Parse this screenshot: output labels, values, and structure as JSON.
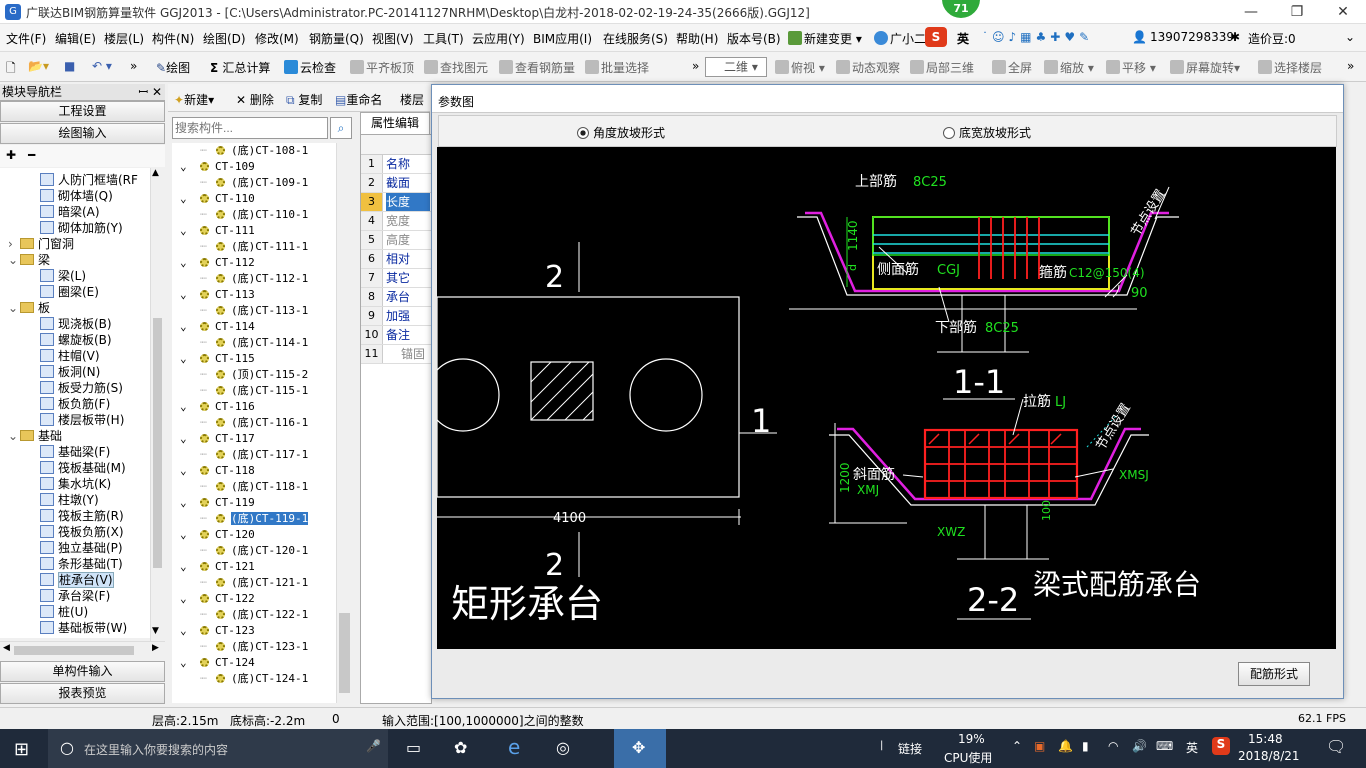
{
  "window": {
    "title": "广联达BIM钢筋算量软件 GGJ2013 - [C:\\Users\\Administrator.PC-20141127NRHM\\Desktop\\白龙村-2018-02-02-19-24-35(2666版).GGJ12]",
    "badge": "71",
    "minimize": "—",
    "restore": "❐",
    "close": "✕"
  },
  "menu": [
    "文件(F)",
    "编辑(E)",
    "楼层(L)",
    "构件(N)",
    "绘图(D)",
    "修改(M)",
    "钢筋量(Q)",
    "视图(V)",
    "工具(T)",
    "云应用(Y)",
    "BIM应用(I)",
    "在线服务(S)",
    "帮助(H)",
    "版本号(B)",
    "新建变更 ▾",
    "广小二"
  ],
  "menu_right": {
    "ime": "英",
    "phone": "13907298339",
    "price": "造价豆:0"
  },
  "toolbar": {
    "draw": "绘图",
    "sum": "汇总计算",
    "cloud_check": "云检查",
    "align_top": "平齐板顶",
    "find": "查找图元",
    "view_rebar": "查看钢筋量",
    "batch": "批量选择",
    "view_mode": "二维",
    "top_view": "俯视",
    "dynamic": "动态观察",
    "local3d": "局部三维",
    "fullscreen": "全屏",
    "zoom": "缩放",
    "pan": "平移",
    "rotate": "屏幕旋转",
    "select_floor": "选择楼层"
  },
  "nav": {
    "header": "模块导航栏",
    "pin": "ꟷ ✕",
    "project": "工程设置",
    "draw_input": "绘图输入",
    "single": "单构件输入",
    "report": "报表预览"
  },
  "tree": [
    {
      "label": "人防门框墙(RF",
      "indent": 3
    },
    {
      "label": "砌体墙(Q)",
      "indent": 3
    },
    {
      "label": "暗梁(A)",
      "indent": 3
    },
    {
      "label": "砌体加筋(Y)",
      "indent": 3
    },
    {
      "label": "门窗洞",
      "indent": 1,
      "folder": true,
      "arrow": "›"
    },
    {
      "label": "梁",
      "indent": 1,
      "folder": true,
      "arrow": "⌄"
    },
    {
      "label": "梁(L)",
      "indent": 3
    },
    {
      "label": "圈梁(E)",
      "indent": 3
    },
    {
      "label": "板",
      "indent": 1,
      "folder": true,
      "arrow": "⌄"
    },
    {
      "label": "现浇板(B)",
      "indent": 3
    },
    {
      "label": "螺旋板(B)",
      "indent": 3
    },
    {
      "label": "柱帽(V)",
      "indent": 3
    },
    {
      "label": "板洞(N)",
      "indent": 3
    },
    {
      "label": "板受力筋(S)",
      "indent": 3
    },
    {
      "label": "板负筋(F)",
      "indent": 3
    },
    {
      "label": "楼层板带(H)",
      "indent": 3
    },
    {
      "label": "基础",
      "indent": 1,
      "folder": true,
      "arrow": "⌄"
    },
    {
      "label": "基础梁(F)",
      "indent": 3
    },
    {
      "label": "筏板基础(M)",
      "indent": 3
    },
    {
      "label": "集水坑(K)",
      "indent": 3
    },
    {
      "label": "柱墩(Y)",
      "indent": 3
    },
    {
      "label": "筏板主筋(R)",
      "indent": 3
    },
    {
      "label": "筏板负筋(X)",
      "indent": 3
    },
    {
      "label": "独立基础(P)",
      "indent": 3
    },
    {
      "label": "条形基础(T)",
      "indent": 3
    },
    {
      "label": "桩承台(V)",
      "indent": 3,
      "selected": true
    },
    {
      "label": "承台梁(F)",
      "indent": 3
    },
    {
      "label": "桩(U)",
      "indent": 3
    },
    {
      "label": "基础板带(W)",
      "indent": 3
    }
  ],
  "comp_toolbar": {
    "new": "新建",
    "delete": "删除",
    "copy": "复制",
    "rename": "重命名",
    "floor": "楼层"
  },
  "search": {
    "placeholder": "搜索构件..."
  },
  "comps": [
    {
      "label": "(底)CT-108-1",
      "child": true
    },
    {
      "label": "CT-109"
    },
    {
      "label": "(底)CT-109-1",
      "child": true
    },
    {
      "label": "CT-110"
    },
    {
      "label": "(底)CT-110-1",
      "child": true
    },
    {
      "label": "CT-111"
    },
    {
      "label": "(底)CT-111-1",
      "child": true
    },
    {
      "label": "CT-112"
    },
    {
      "label": "(底)CT-112-1",
      "child": true
    },
    {
      "label": "CT-113"
    },
    {
      "label": "(底)CT-113-1",
      "child": true
    },
    {
      "label": "CT-114"
    },
    {
      "label": "(底)CT-114-1",
      "child": true
    },
    {
      "label": "CT-115"
    },
    {
      "label": "(顶)CT-115-2",
      "child": true
    },
    {
      "label": "(底)CT-115-1",
      "child": true
    },
    {
      "label": "CT-116"
    },
    {
      "label": "(底)CT-116-1",
      "child": true
    },
    {
      "label": "CT-117"
    },
    {
      "label": "(底)CT-117-1",
      "child": true
    },
    {
      "label": "CT-118"
    },
    {
      "label": "(底)CT-118-1",
      "child": true
    },
    {
      "label": "CT-119"
    },
    {
      "label": "(底)CT-119-1",
      "child": true,
      "selected": true
    },
    {
      "label": "CT-120"
    },
    {
      "label": "(底)CT-120-1",
      "child": true
    },
    {
      "label": "CT-121"
    },
    {
      "label": "(底)CT-121-1",
      "child": true
    },
    {
      "label": "CT-122"
    },
    {
      "label": "(底)CT-122-1",
      "child": true
    },
    {
      "label": "CT-123"
    },
    {
      "label": "(底)CT-123-1",
      "child": true
    },
    {
      "label": "CT-124"
    },
    {
      "label": "(底)CT-124-1",
      "child": true
    }
  ],
  "props": {
    "tab": "属性编辑",
    "rows": [
      {
        "n": "1",
        "v": "名称"
      },
      {
        "n": "2",
        "v": "截面"
      },
      {
        "n": "3",
        "v": "长度",
        "selected": true
      },
      {
        "n": "4",
        "v": "宽度",
        "gray": true
      },
      {
        "n": "5",
        "v": "高度",
        "gray": true
      },
      {
        "n": "6",
        "v": "相对"
      },
      {
        "n": "7",
        "v": "其它"
      },
      {
        "n": "8",
        "v": "承台"
      },
      {
        "n": "9",
        "v": "加强"
      },
      {
        "n": "10",
        "v": "备注"
      },
      {
        "n": "11",
        "v": "锚固",
        "plus": true
      }
    ]
  },
  "dialog": {
    "title": "参数图",
    "radio1": "角度放坡形式",
    "radio2": "底宽放坡形式",
    "button": "配筋形式"
  },
  "cad": {
    "top_rebar": "上部筋",
    "top_rebar_v": "8C25",
    "node": "节点设置",
    "h1140": "1140",
    "side": "侧面筋",
    "side_v": "CGJ",
    "stirrup": "箍筋",
    "stirrup_v": "C12@150(4)",
    "ang": "90",
    "bottom": "下部筋",
    "bottom_v": "8C25",
    "sec11": "1-1",
    "tie": "拉筋",
    "tie_v": "LJ",
    "node2": "节点设置",
    "h1200": "1200",
    "slope": "斜面筋",
    "slope_v": "XMJ",
    "xmsj": "XMSJ",
    "xwz": "XWZ",
    "d100": "100",
    "sec22": "2-2",
    "beam_title": "梁式配筋承台",
    "m2a": "2",
    "m1": "1",
    "m2b": "2",
    "w4100": "4100",
    "rect_title": "矩形承台"
  },
  "status": {
    "floor_h": "层高:2.15m",
    "bottom_h": "底标高:-2.2m",
    "zero": "0",
    "hint": "输入范围:[100,1000000]之间的整数",
    "fps": "62.1 FPS"
  },
  "taskbar": {
    "search": "在这里输入你要搜索的内容",
    "link": "链接",
    "cpu": "19%",
    "cpu_label": "CPU使用",
    "ime": "英",
    "time": "15:48",
    "date": "2018/8/21"
  }
}
